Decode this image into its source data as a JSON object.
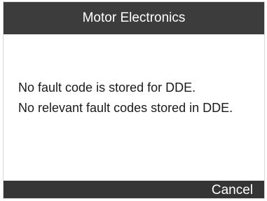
{
  "window": {
    "title": "Motor Electronics"
  },
  "message": {
    "lines": [
      "No fault code is stored for DDE.",
      "No relevant fault codes stored in DDE."
    ]
  },
  "footer": {
    "cancel_label": "Cancel"
  },
  "colors": {
    "title_bar": "#3c3c3c",
    "footer_bar": "#353535",
    "background": "#ffffff",
    "text": "#1a1a1a"
  }
}
